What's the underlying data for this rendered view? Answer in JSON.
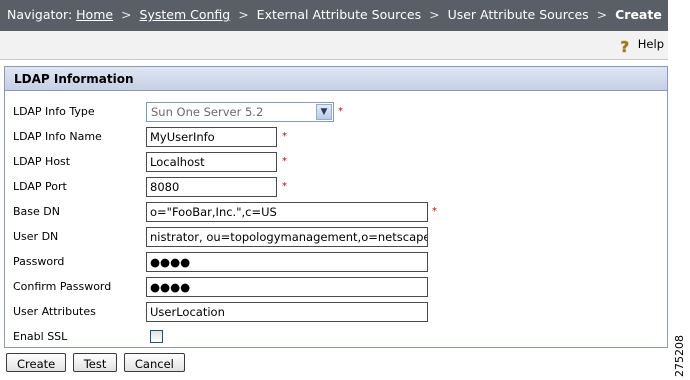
{
  "navigator": {
    "label": "Navigator:",
    "home": "Home",
    "system_config": "System Config",
    "external_sources": "External Attribute Sources",
    "user_sources": "User Attribute Sources",
    "current": "Create",
    "separator": ">"
  },
  "toolbar": {
    "help_label": "Help",
    "help_icon": "?"
  },
  "panel": {
    "title": "LDAP Information"
  },
  "form": {
    "info_type": {
      "label": "LDAP Info Type",
      "value": "Sun One Server 5.2"
    },
    "info_name": {
      "label": "LDAP Info Name",
      "value": "MyUserInfo"
    },
    "host": {
      "label": "LDAP Host",
      "value": "Localhost"
    },
    "port": {
      "label": "LDAP Port",
      "value": "8080"
    },
    "base_dn": {
      "label": "Base DN",
      "value": "o=\"FooBar,Inc.\",c=US"
    },
    "user_dn": {
      "label": "User DN",
      "value": "nistrator, ou=topologymanagement,o=netscaperoot"
    },
    "password": {
      "label": "Password",
      "value": "●●●●"
    },
    "confirm_password": {
      "label": "Confirm Password",
      "value": "●●●●"
    },
    "user_attributes": {
      "label": "User Attributes",
      "value": "UserLocation"
    },
    "ssl": {
      "label": "Enabl SSL",
      "checked": false
    },
    "required_marker": "*"
  },
  "buttons": {
    "create": "Create",
    "test": "Test",
    "cancel": "Cancel"
  },
  "figure_id": "275208"
}
